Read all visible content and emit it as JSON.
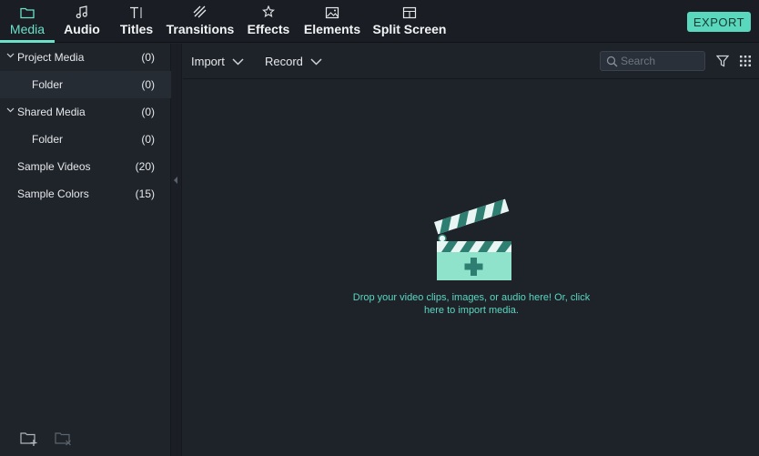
{
  "toolbar": {
    "tabs": [
      {
        "label": "Media",
        "icon": "folder-icon"
      },
      {
        "label": "Audio",
        "icon": "music-note-icon"
      },
      {
        "label": "Titles",
        "icon": "text-icon"
      },
      {
        "label": "Transitions",
        "icon": "transition-icon"
      },
      {
        "label": "Effects",
        "icon": "effects-icon"
      },
      {
        "label": "Elements",
        "icon": "image-icon"
      },
      {
        "label": "Split Screen",
        "icon": "split-screen-icon"
      }
    ],
    "active_tab": "Media",
    "export_label": "EXPORT"
  },
  "sidebar": {
    "items": [
      {
        "label": "Project Media",
        "count": "(0)",
        "expanded": true
      },
      {
        "label": "Folder",
        "count": "(0)",
        "selected": true
      },
      {
        "label": "Shared Media",
        "count": "(0)",
        "expanded": true
      },
      {
        "label": "Folder",
        "count": "(0)"
      },
      {
        "label": "Sample Videos",
        "count": "(20)"
      },
      {
        "label": "Sample Colors",
        "count": "(15)"
      }
    ],
    "tools": [
      "new-folder-icon",
      "delete-folder-icon"
    ]
  },
  "main": {
    "import_label": "Import",
    "record_label": "Record",
    "search_placeholder": "Search",
    "drop_line1": "Drop your video clips, images, or audio here! Or, click",
    "drop_line2": "here to import media."
  },
  "colors": {
    "accent": "#5ad8be",
    "background": "#1e232a"
  }
}
